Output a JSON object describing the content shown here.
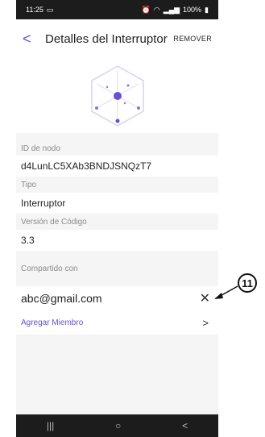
{
  "status": {
    "time": "11:25",
    "right": "100%"
  },
  "header": {
    "title": "Detalles del Interruptor",
    "remove_label": "REMOVER"
  },
  "fields": {
    "node_id": {
      "label": "ID de nodo",
      "value": "d4LunLC5XAb3BNDJSNQzT7"
    },
    "type": {
      "label": "Tipo",
      "value": "Interruptor"
    },
    "version": {
      "label": "Versión de Código",
      "value": "3.3"
    },
    "shared": {
      "label": "Compartido con"
    }
  },
  "shared_email": "abc@gmail.com",
  "add_member_label": "Agregar Miembro",
  "callout_number": "11",
  "icons": {
    "back": "chevron-left-icon",
    "close": "close-icon",
    "next": "chevron-right-icon",
    "device": "hexagon-network-icon"
  },
  "colors": {
    "accent": "#6a4fd3",
    "status_bar": "#1c1c1c",
    "background": "#f5f5f6"
  }
}
